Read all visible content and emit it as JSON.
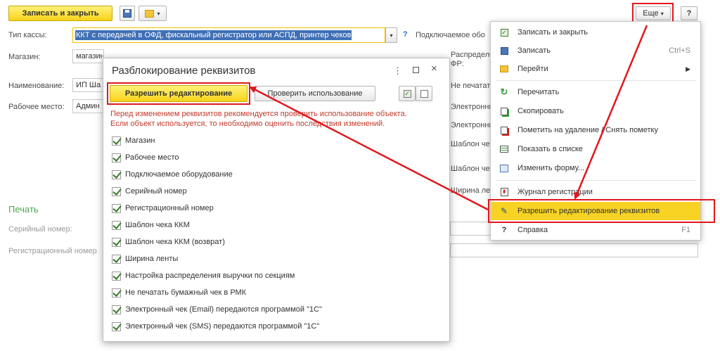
{
  "toolbar": {
    "save_close_label": "Записать и закрыть",
    "more_label": "Еще",
    "help_label": "?"
  },
  "form": {
    "cash_type_label": "Тип кассы:",
    "cash_type_value": "ККТ с передачей в ОФД, фискальный регистратор или АСПД, принтер чеков",
    "cash_type_help": "?",
    "shop_label": "Магазин:",
    "shop_value": "магазин",
    "name_label": "Наименование:",
    "name_value": "ИП Ша",
    "workplace_label": "Рабочее место:",
    "workplace_value": "Админ",
    "right_labels": [
      "Подключаемое обо",
      "Распределение вы",
      "ФР:",
      "Не печатать бу",
      "Электронный че",
      "Электронный че",
      "Шаблон чека ККМ (",
      "Шаблон чека ККМ (",
      "Ширина ленты:"
    ],
    "print_section": "Печать",
    "serial_label": "Серийный номер:",
    "reg_label": "Регистрационный номер"
  },
  "dialog": {
    "title": "Разблокирование реквизитов",
    "allow_edit_label": "Разрешить редактирование",
    "check_usage_label": "Проверить использование",
    "warning_line1": "Перед изменением реквизитов рекомендуется проверить использование объекта.",
    "warning_line2": "Если объект используется, то необходимо оценить последствия изменений.",
    "items": [
      "Магазин",
      "Рабочее место",
      "Подключаемое оборудование",
      "Серийный номер",
      "Регистрационный номер",
      "Шаблон чека ККМ",
      "Шаблон чека ККМ (возврат)",
      "Ширина ленты",
      "Настройка распределения выручки по секциям",
      "Не печатать бумажный чек в РМК",
      "Электронный чек (Email) передаются программой \"1С\"",
      "Электронный чек (SMS) передаются программой \"1С\""
    ]
  },
  "menu": {
    "items": [
      {
        "label": "Записать и закрыть",
        "shortcut": "",
        "icon": "save-close-icon"
      },
      {
        "label": "Записать",
        "shortcut": "Ctrl+S",
        "icon": "floppy-icon"
      },
      {
        "label": "Перейти",
        "shortcut": "",
        "icon": "goto-icon"
      },
      {
        "label": "Перечитать",
        "shortcut": "",
        "icon": "refresh-icon"
      },
      {
        "label": "Скопировать",
        "shortcut": "",
        "icon": "copy-icon"
      },
      {
        "label": "Пометить на удаление / Снять пометку",
        "shortcut": "",
        "icon": "delete-mark-icon"
      },
      {
        "label": "Показать в списке",
        "shortcut": "",
        "icon": "list-icon"
      },
      {
        "label": "Изменить форму...",
        "shortcut": "",
        "icon": "form-edit-icon"
      },
      {
        "label": "Журнал регистрации",
        "shortcut": "",
        "icon": "log-icon"
      },
      {
        "label": "Разрешить редактирование реквизитов",
        "shortcut": "",
        "icon": "edit-pencil-icon"
      },
      {
        "label": "Справка",
        "shortcut": "F1",
        "icon": "help-icon"
      }
    ]
  },
  "colors": {
    "accent_yellow": "#f7d31a",
    "highlight_red": "#e1171c",
    "section_green": "#4ca64c",
    "warning_red": "#c0392b"
  }
}
